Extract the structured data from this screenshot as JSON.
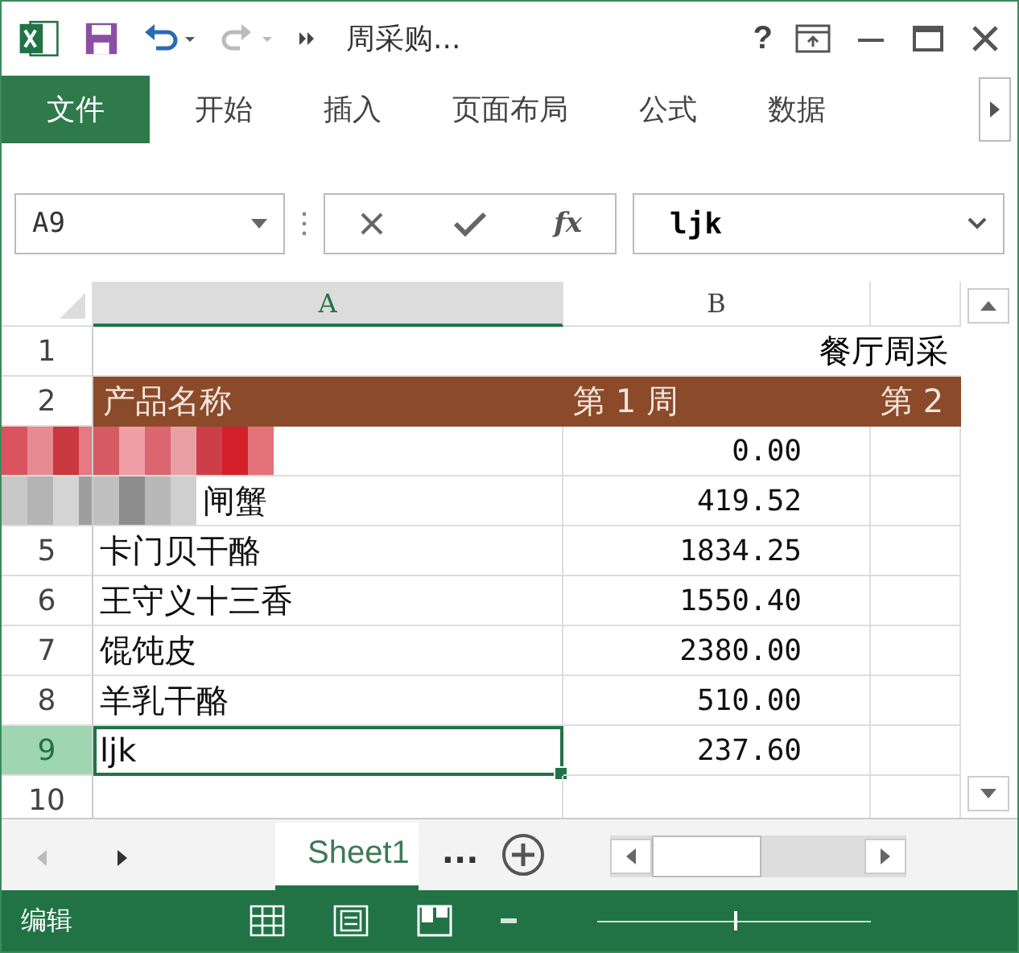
{
  "title_bar": {
    "title": "周采购...",
    "redo_disabled": true,
    "help": "?"
  },
  "ribbon_tabs": [
    {
      "label": "文件",
      "kind": "file"
    },
    {
      "label": "开始",
      "kind": "tab"
    },
    {
      "label": "插入",
      "kind": "tab"
    },
    {
      "label": "页面布局",
      "kind": "tab"
    },
    {
      "label": "公式",
      "kind": "tab"
    },
    {
      "label": "数据",
      "kind": "tab"
    }
  ],
  "formula_bar": {
    "name_box": "A9",
    "function_label": "fx",
    "formula": "ljk"
  },
  "columns": [
    {
      "label": "A",
      "selected": true
    },
    {
      "label": "B",
      "selected": false
    }
  ],
  "title_row": {
    "row": "1",
    "text": "餐厅周采"
  },
  "header_row": {
    "row": "2",
    "cells": [
      "产品名称",
      "第 1 周",
      "第 2"
    ]
  },
  "rows": [
    {
      "name": "",
      "value": "0.00",
      "masked": true,
      "selected": false
    },
    {
      "name": "闸蟹",
      "value": "419.52",
      "masked": true,
      "selected": false
    },
    {
      "row": "5",
      "name": "卡门贝干酪",
      "value": "1834.25",
      "selected": false
    },
    {
      "row": "6",
      "name": "王守义十三香",
      "value": "1550.40",
      "selected": false
    },
    {
      "row": "7",
      "name": "馄饨皮",
      "value": "2380.00",
      "selected": false
    },
    {
      "row": "8",
      "name": "羊乳干酪",
      "value": "510.00",
      "selected": false
    },
    {
      "row": "9",
      "name": "ljk",
      "value": "237.60",
      "selected": true
    },
    {
      "row": "10",
      "selected": false
    }
  ],
  "sheet_tabs": [
    {
      "label": "Sheet1",
      "selected": true
    }
  ],
  "more_sheets": "...",
  "status_bar": {
    "mode": "编辑",
    "zoom": {
      "level": 0.5
    }
  }
}
